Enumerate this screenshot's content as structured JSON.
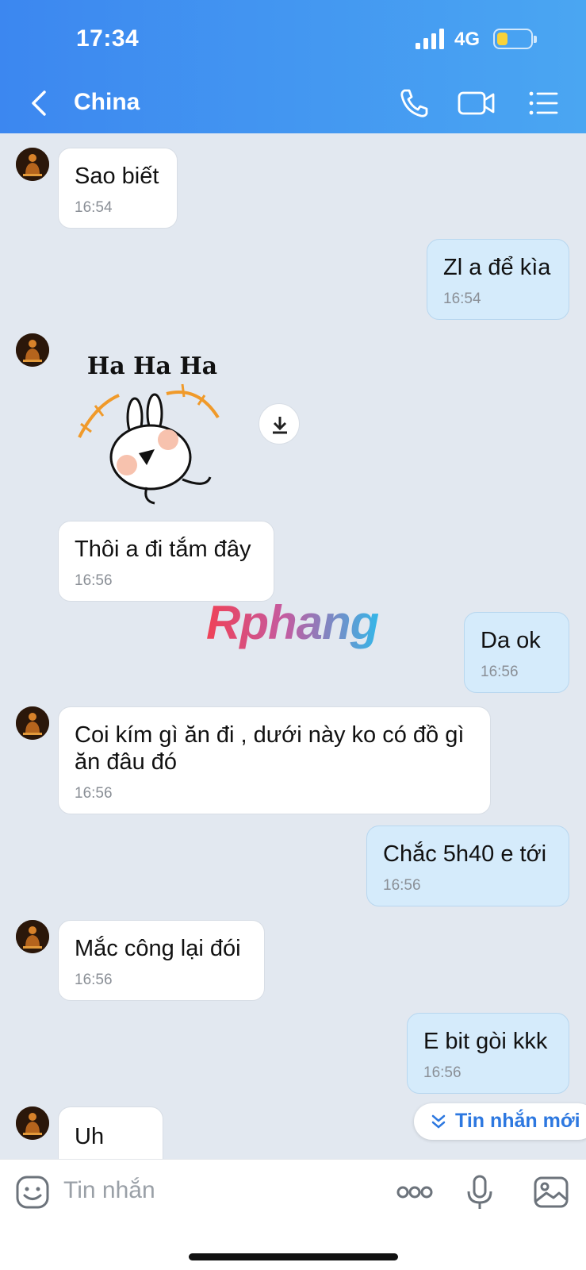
{
  "status_bar": {
    "time": "17:34",
    "network": "4G"
  },
  "header": {
    "contact_name": "China"
  },
  "messages": [
    {
      "text": "Sao biết",
      "time": "16:54"
    },
    {
      "text": "Zl a để kìa",
      "time": "16:54"
    },
    {
      "sticker_text": "Ha Ha Ha"
    },
    {
      "text": "Thôi a đi tắm đây",
      "time": "16:56"
    },
    {
      "text": "Da ok",
      "time": "16:56"
    },
    {
      "text": "Coi kím gì ăn đi , dưới này ko có đồ gì ăn đâu đó",
      "time": "16:56"
    },
    {
      "text": "Chắc 5h40 e tới",
      "time": "16:56"
    },
    {
      "text": "Mắc công lại đói",
      "time": "16:56"
    },
    {
      "text": "E bit gòi kkk",
      "time": "16:56"
    },
    {
      "text": "Uh"
    }
  ],
  "watermark": "Rphang",
  "new_message_pill": "Tin nhắn mới",
  "composer": {
    "placeholder": "Tin nhắn"
  },
  "colors": {
    "header": "#3c87f0",
    "incoming": "#ffffff",
    "outgoing": "#d5ebfb",
    "accent": "#2d78e0"
  }
}
